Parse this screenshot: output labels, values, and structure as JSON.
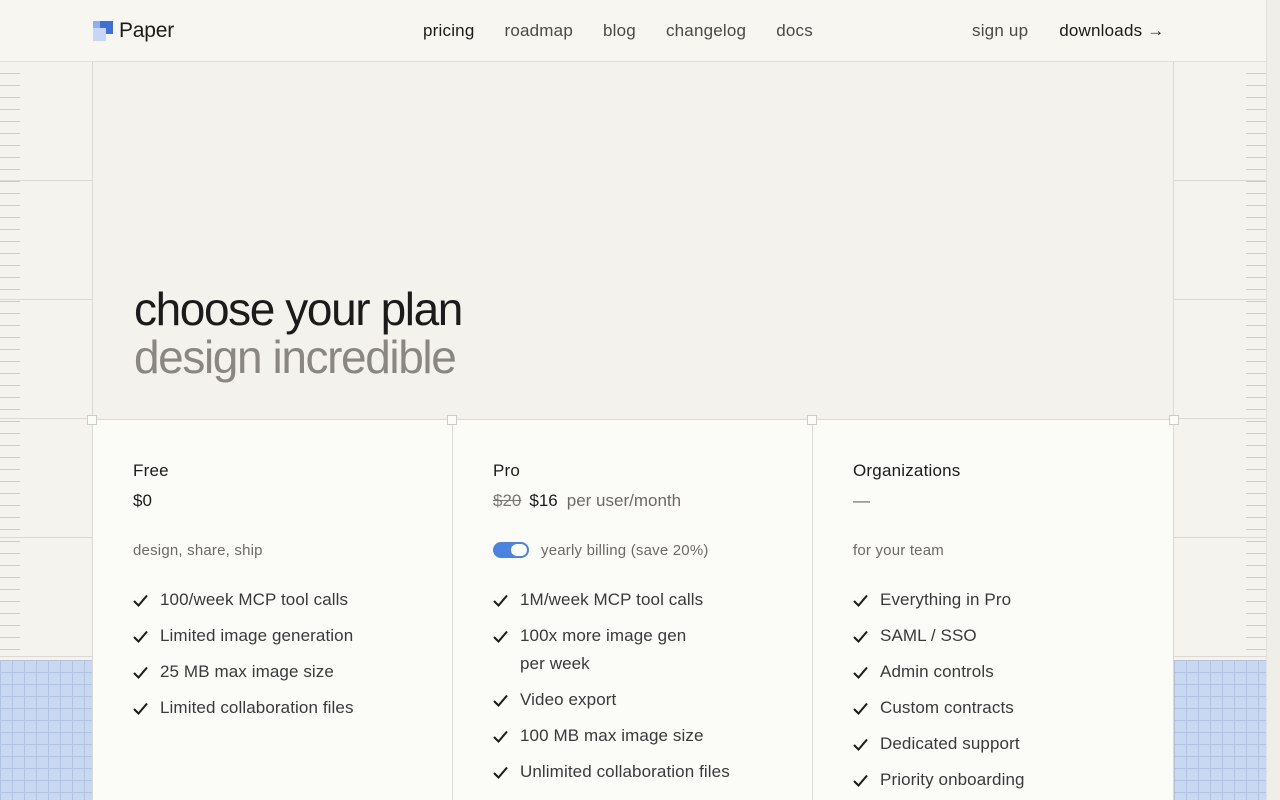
{
  "nav": {
    "logo_text": "Paper",
    "links": [
      "pricing",
      "roadmap",
      "blog",
      "changelog",
      "docs"
    ],
    "signup": "sign up",
    "downloads": "downloads →"
  },
  "hero": {
    "title": "choose your plan",
    "subtitle": "design incredible"
  },
  "plans": [
    {
      "name": "Free",
      "price": "$0",
      "tagline": "design, share, ship",
      "features": [
        "100/week MCP tool calls",
        "Limited image generation",
        "25 MB max image size",
        "Limited collaboration files"
      ]
    },
    {
      "name": "Pro",
      "price_old": "$20",
      "price": "$16",
      "price_unit": "per user/month",
      "tagline": "yearly billing (save 20%)",
      "yearly_billing_on": true,
      "features": [
        "1M/week MCP tool calls",
        "100x more image gen per week",
        "Video export",
        "100 MB max image size",
        "Unlimited collaboration files"
      ]
    },
    {
      "name": "Organizations",
      "price": "—",
      "tagline": "for your team",
      "features": [
        "Everything in Pro",
        "SAML / SSO",
        "Admin controls",
        "Custom contracts",
        "Dedicated support",
        "Priority onboarding"
      ]
    }
  ],
  "colors": {
    "accent": "#4a84e0",
    "logo_blue": "#3e6fd8",
    "grid_blue": "#c9d8f1"
  },
  "icons": {
    "feature": "check-icon",
    "logo": "paper-logo-icon"
  }
}
